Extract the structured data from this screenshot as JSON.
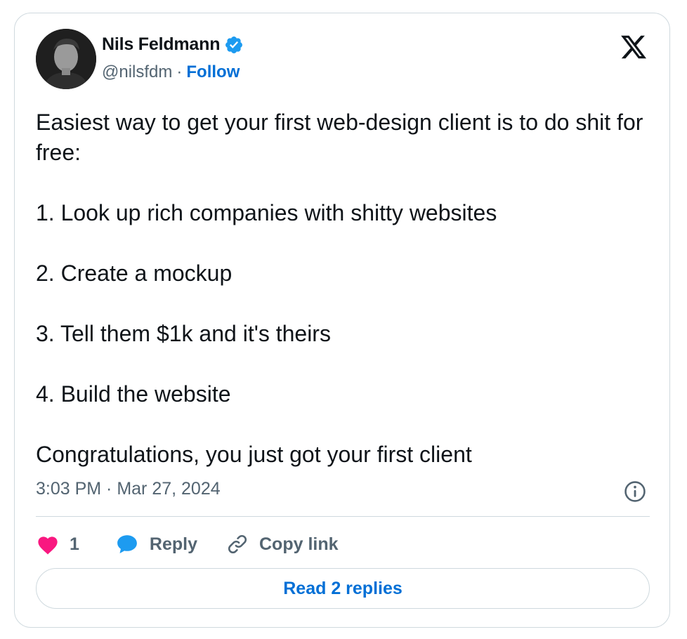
{
  "author": {
    "display_name": "Nils Feldmann",
    "handle": "@nilsfdm",
    "separator": "·",
    "follow_label": "Follow",
    "avatar_icon": "profile-photo",
    "verified_icon": "verified-badge-icon",
    "verified_color": "#1d9bf0"
  },
  "platform_icon": "x-logo-icon",
  "tweet": {
    "lines": [
      "Easiest way to get your first web-design client is to do shit for free:",
      "1. Look up rich companies with shitty websites",
      "2. Create a mockup",
      "3. Tell them $1k and it's theirs",
      "4. Build the website",
      "Congratulations, you just got your first client"
    ],
    "timestamp": "3:03 PM · Mar 27, 2024",
    "info_icon": "info-icon"
  },
  "actions": {
    "like_count": "1",
    "like_icon": "heart-icon",
    "like_color": "#f91880",
    "reply_label": "Reply",
    "reply_icon": "speech-bubble-icon",
    "reply_color": "#1d9bf0",
    "copy_label": "Copy link",
    "copy_icon": "link-icon"
  },
  "read_replies_label": "Read 2 replies",
  "colors": {
    "text_primary": "#0f1419",
    "text_secondary": "#536471",
    "link": "#006fd6",
    "border": "#cfd9de"
  }
}
